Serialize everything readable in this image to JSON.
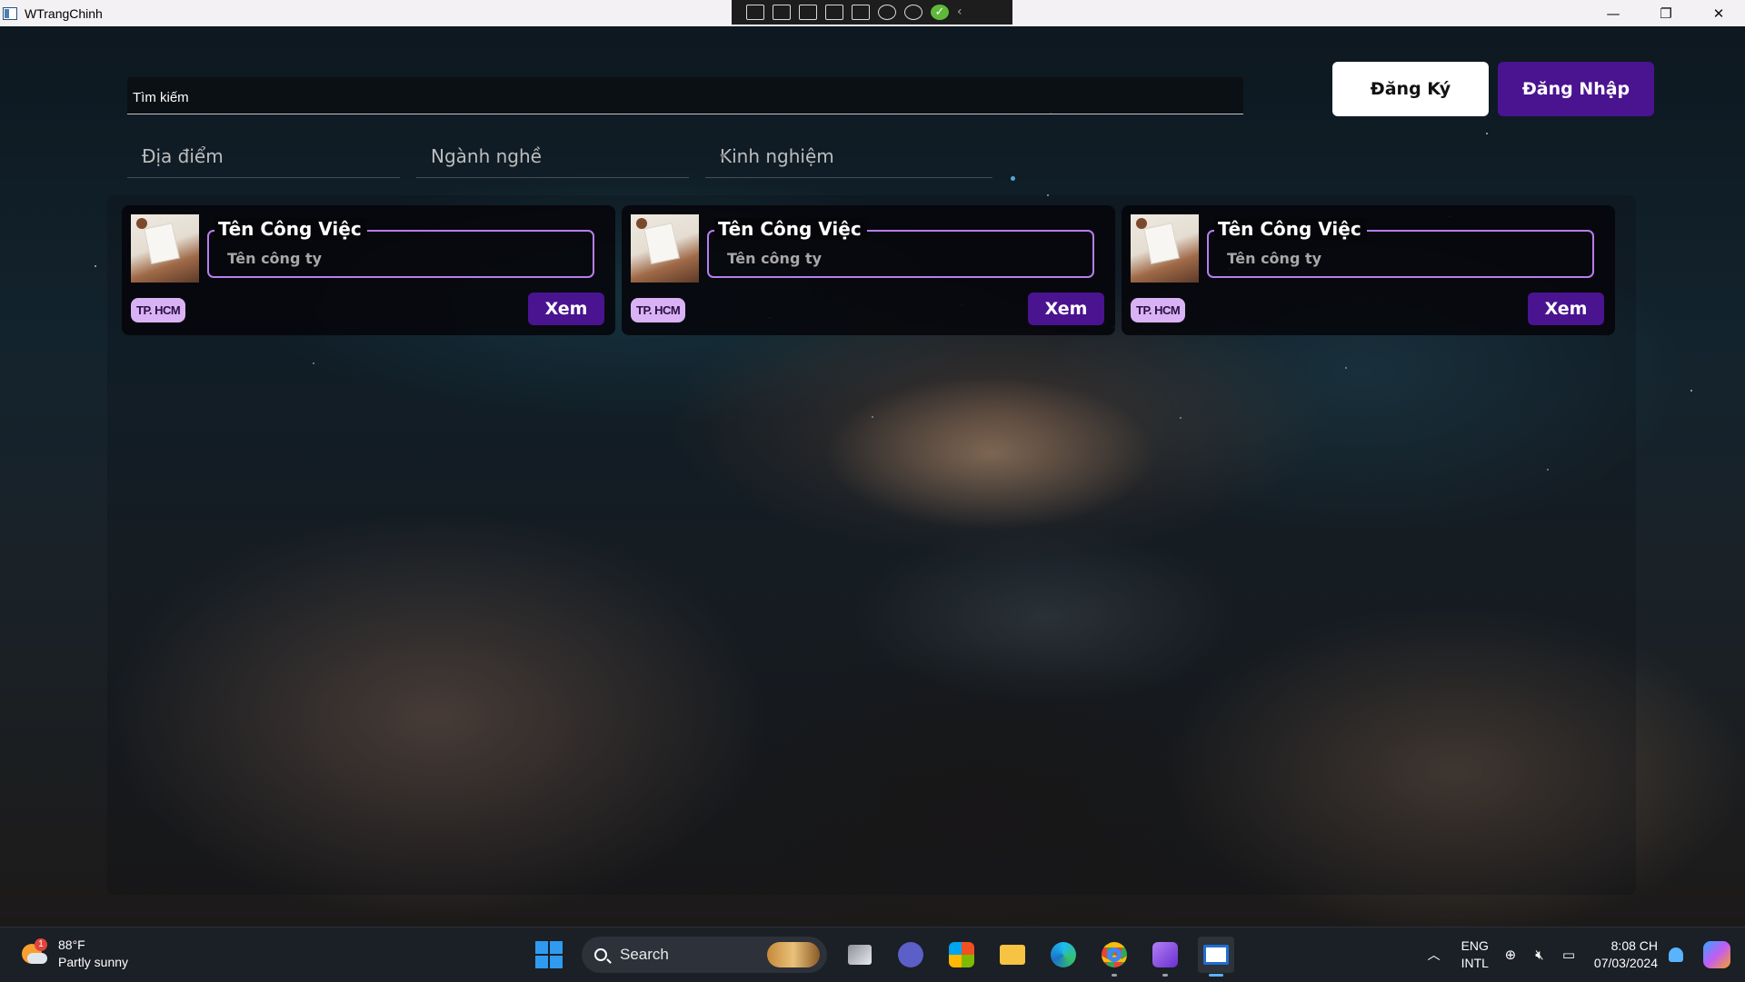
{
  "window": {
    "title": "WTrangChinh",
    "controls": [
      "minimize-icon",
      "restore-icon",
      "close-icon"
    ]
  },
  "search": {
    "placeholder": "Tìm kiếm"
  },
  "auth": {
    "register_label": "Đăng Ký",
    "login_label": "Đăng Nhập"
  },
  "filters": [
    {
      "label": "Địa điểm"
    },
    {
      "label": "Ngành nghề"
    },
    {
      "label": "Kinh nghiệm"
    }
  ],
  "jobs": [
    {
      "title": "Tên Công Việc",
      "company": "Tên công ty",
      "location": "TP. HCM",
      "action": "Xem"
    },
    {
      "title": "Tên Công Việc",
      "company": "Tên công ty",
      "location": "TP. HCM",
      "action": "Xem"
    },
    {
      "title": "Tên Công Việc",
      "company": "Tên công ty",
      "location": "TP. HCM",
      "action": "Xem"
    }
  ],
  "colors": {
    "accent_purple": "#4a1390",
    "card_border": "#b77ef0",
    "location_badge": "#d9b2f5"
  },
  "taskbar": {
    "weather_temp": "88°F",
    "weather_desc": "Partly sunny",
    "weather_badge": "1",
    "search_label": "Search",
    "lang_line1": "ENG",
    "lang_line2": "INTL",
    "time": "8:08 CH",
    "date": "07/03/2024"
  }
}
